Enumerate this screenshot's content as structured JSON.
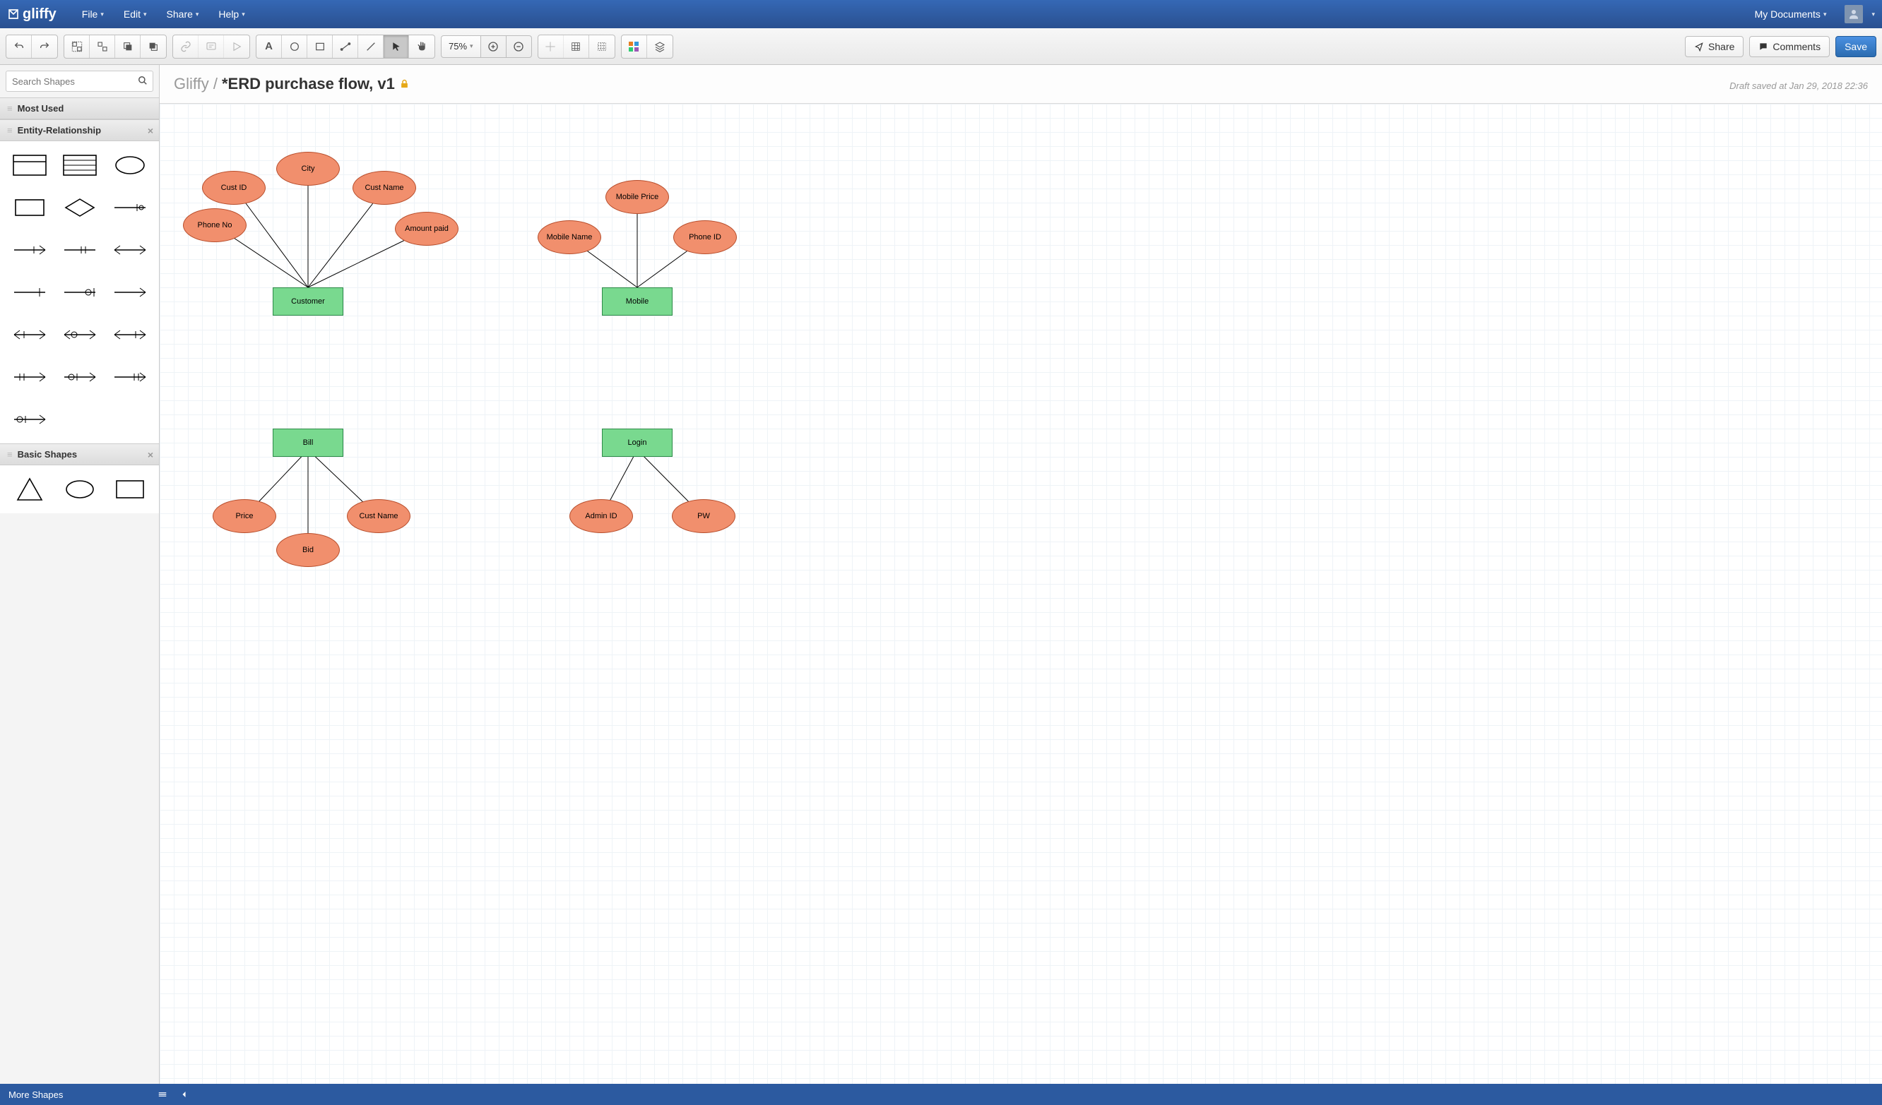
{
  "app": {
    "name": "gliffy"
  },
  "menubar": {
    "items": [
      "File",
      "Edit",
      "Share",
      "Help"
    ],
    "my_documents": "My Documents"
  },
  "toolbar": {
    "zoom": "75%",
    "share": "Share",
    "comments": "Comments",
    "save": "Save"
  },
  "sidebar": {
    "search_placeholder": "Search Shapes",
    "panels": {
      "most_used": "Most Used",
      "er": "Entity-Relationship",
      "basic": "Basic Shapes"
    },
    "more_shapes": "More Shapes"
  },
  "document": {
    "breadcrumb": "Gliffy /",
    "title": "*ERD purchase flow, v1",
    "draft_status": "Draft saved at Jan 29, 2018 22:36"
  },
  "diagram": {
    "entities": {
      "customer": "Customer",
      "mobile": "Mobile",
      "bill": "Bill",
      "login": "Login"
    },
    "attributes": {
      "phone_no": "Phone No",
      "cust_id": "Cust ID",
      "city": "City",
      "cust_name": "Cust Name",
      "amount_paid": "Amount paid",
      "mobile_name": "Mobile Name",
      "mobile_price": "Mobile Price",
      "phone_id": "Phone ID",
      "price": "Price",
      "bid": "Bid",
      "cust_name2": "Cust Name",
      "admin_id": "Admin ID",
      "pw": "PW"
    }
  }
}
